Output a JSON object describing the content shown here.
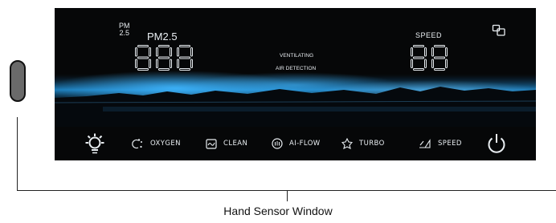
{
  "display": {
    "pm_icon_line1": "PM",
    "pm_icon_line2": "2.5",
    "pm_label": "PM2.5",
    "pm_value": "888",
    "speed_label": "SPEED",
    "speed_value": "88",
    "mode_line1": "VENTILATING",
    "mode_line2": "AIR DETECTION",
    "aux_icon": "window-switch-icon"
  },
  "buttons": [
    {
      "label": "",
      "icon": "light-icon"
    },
    {
      "label": "OXYGEN",
      "icon": "oxygen-icon"
    },
    {
      "label": "CLEAN",
      "icon": "clean-icon"
    },
    {
      "label": "AI-FLOW",
      "icon": "ai-flow-icon"
    },
    {
      "label": "TURBO",
      "icon": "turbo-icon"
    },
    {
      "label": "SPEED",
      "icon": "speed-icon"
    },
    {
      "label": "",
      "icon": "power-icon"
    }
  ],
  "caption": "Hand Sensor Window",
  "colors": {
    "panel": "#060708",
    "text": "#e9eef2",
    "glow_blue": "#1f8fd6",
    "sensor": "#6a6a6a"
  }
}
